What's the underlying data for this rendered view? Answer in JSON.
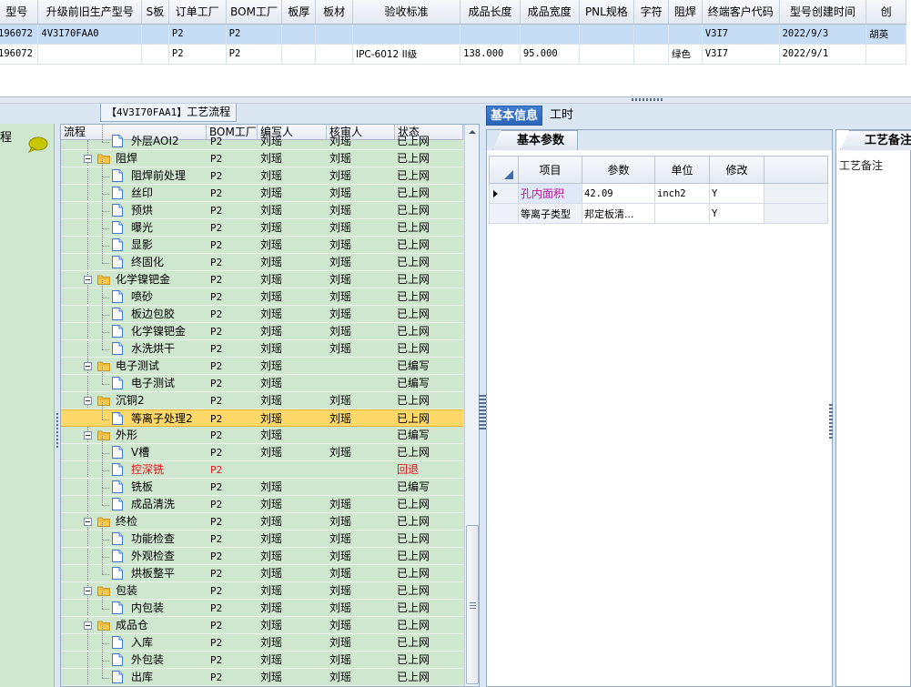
{
  "top_grid": {
    "columns": [
      "型号",
      "升级前旧生产型号",
      "S板",
      "订单工厂",
      "BOM工厂",
      "板厚",
      "板材",
      "验收标准",
      "成品长度",
      "成品宽度",
      "PNL规格",
      "字符",
      "阻焊",
      "终端客户代码",
      "型号创建时间",
      "创"
    ],
    "rows": [
      [
        "196072",
        "4V3I70FAA0",
        "",
        "P2",
        "P2",
        "",
        "",
        "",
        "",
        "",
        "",
        "",
        "",
        "V3I7",
        "2022/9/3",
        "胡英"
      ],
      [
        "196072",
        "",
        "",
        "P2",
        "P2",
        "",
        "",
        "IPC-6012 II级",
        "138.000",
        "95.000",
        "",
        "",
        "绿色",
        "V3I7",
        "2022/9/1",
        ""
      ]
    ]
  },
  "left_strip": {
    "label": "程",
    "icon": "speech-bubble-icon"
  },
  "tree_panel": {
    "title_code": "【4V3I70FAA1】",
    "title_text": "工艺流程",
    "columns": [
      "流程",
      "BOM工厂",
      "编写人",
      "核审人",
      "状态"
    ],
    "rows": [
      {
        "name": "外层AOI2",
        "level": 1,
        "type": "doc",
        "bom": "P2",
        "author": "刘瑶",
        "reviewer": "刘瑶",
        "status": "已上网"
      },
      {
        "name": "阻焊",
        "level": 0,
        "type": "folder",
        "bom": "P2",
        "author": "刘瑶",
        "reviewer": "刘瑶",
        "status": "已上网"
      },
      {
        "name": "阻焊前处理",
        "level": 1,
        "type": "doc",
        "bom": "P2",
        "author": "刘瑶",
        "reviewer": "刘瑶",
        "status": "已上网"
      },
      {
        "name": "丝印",
        "level": 1,
        "type": "doc",
        "bom": "P2",
        "author": "刘瑶",
        "reviewer": "刘瑶",
        "status": "已上网"
      },
      {
        "name": "预烘",
        "level": 1,
        "type": "doc",
        "bom": "P2",
        "author": "刘瑶",
        "reviewer": "刘瑶",
        "status": "已上网"
      },
      {
        "name": "曝光",
        "level": 1,
        "type": "doc",
        "bom": "P2",
        "author": "刘瑶",
        "reviewer": "刘瑶",
        "status": "已上网"
      },
      {
        "name": "显影",
        "level": 1,
        "type": "doc",
        "bom": "P2",
        "author": "刘瑶",
        "reviewer": "刘瑶",
        "status": "已上网"
      },
      {
        "name": "终固化",
        "level": 1,
        "type": "doc",
        "bom": "P2",
        "author": "刘瑶",
        "reviewer": "刘瑶",
        "status": "已上网"
      },
      {
        "name": "化学镍钯金",
        "level": 0,
        "type": "folder",
        "bom": "P2",
        "author": "刘瑶",
        "reviewer": "刘瑶",
        "status": "已上网"
      },
      {
        "name": "喷砂",
        "level": 1,
        "type": "doc",
        "bom": "P2",
        "author": "刘瑶",
        "reviewer": "刘瑶",
        "status": "已上网"
      },
      {
        "name": "板边包胶",
        "level": 1,
        "type": "doc",
        "bom": "P2",
        "author": "刘瑶",
        "reviewer": "刘瑶",
        "status": "已上网"
      },
      {
        "name": "化学镍钯金",
        "level": 1,
        "type": "doc",
        "bom": "P2",
        "author": "刘瑶",
        "reviewer": "刘瑶",
        "status": "已上网"
      },
      {
        "name": "水洗烘干",
        "level": 1,
        "type": "doc",
        "bom": "P2",
        "author": "刘瑶",
        "reviewer": "刘瑶",
        "status": "已上网"
      },
      {
        "name": "电子测试",
        "level": 0,
        "type": "folder",
        "bom": "P2",
        "author": "刘瑶",
        "reviewer": "",
        "status": "已编写"
      },
      {
        "name": "电子测试",
        "level": 1,
        "type": "doc",
        "bom": "P2",
        "author": "刘瑶",
        "reviewer": "",
        "status": "已编写"
      },
      {
        "name": "沉铜2",
        "level": 0,
        "type": "folder",
        "bom": "P2",
        "author": "刘瑶",
        "reviewer": "刘瑶",
        "status": "已上网"
      },
      {
        "name": "等离子处理2",
        "level": 1,
        "type": "doc",
        "bom": "P2",
        "author": "刘瑶",
        "reviewer": "刘瑶",
        "status": "已上网",
        "selected": true
      },
      {
        "name": "外形",
        "level": 0,
        "type": "folder",
        "bom": "P2",
        "author": "刘瑶",
        "reviewer": "",
        "status": "已编写"
      },
      {
        "name": "V槽",
        "level": 1,
        "type": "doc",
        "bom": "P2",
        "author": "刘瑶",
        "reviewer": "刘瑶",
        "status": "已上网"
      },
      {
        "name": "控深铣",
        "level": 1,
        "type": "doc",
        "bom": "P2",
        "author": "",
        "reviewer": "",
        "status": "回退",
        "red": true
      },
      {
        "name": "铣板",
        "level": 1,
        "type": "doc",
        "bom": "P2",
        "author": "刘瑶",
        "reviewer": "",
        "status": "已编写"
      },
      {
        "name": "成品清洗",
        "level": 1,
        "type": "doc",
        "bom": "P2",
        "author": "刘瑶",
        "reviewer": "刘瑶",
        "status": "已上网"
      },
      {
        "name": "终检",
        "level": 0,
        "type": "folder",
        "bom": "P2",
        "author": "刘瑶",
        "reviewer": "刘瑶",
        "status": "已上网"
      },
      {
        "name": "功能检查",
        "level": 1,
        "type": "doc",
        "bom": "P2",
        "author": "刘瑶",
        "reviewer": "刘瑶",
        "status": "已上网"
      },
      {
        "name": "外观检查",
        "level": 1,
        "type": "doc",
        "bom": "P2",
        "author": "刘瑶",
        "reviewer": "刘瑶",
        "status": "已上网"
      },
      {
        "name": "烘板整平",
        "level": 1,
        "type": "doc",
        "bom": "P2",
        "author": "刘瑶",
        "reviewer": "刘瑶",
        "status": "已上网"
      },
      {
        "name": "包装",
        "level": 0,
        "type": "folder",
        "bom": "P2",
        "author": "刘瑶",
        "reviewer": "刘瑶",
        "status": "已上网"
      },
      {
        "name": "内包装",
        "level": 1,
        "type": "doc",
        "bom": "P2",
        "author": "刘瑶",
        "reviewer": "刘瑶",
        "status": "已上网"
      },
      {
        "name": "成品仓",
        "level": 0,
        "type": "folder",
        "bom": "P2",
        "author": "刘瑶",
        "reviewer": "刘瑶",
        "status": "已上网"
      },
      {
        "name": "入库",
        "level": 1,
        "type": "doc",
        "bom": "P2",
        "author": "刘瑶",
        "reviewer": "刘瑶",
        "status": "已上网"
      },
      {
        "name": "外包装",
        "level": 1,
        "type": "doc",
        "bom": "P2",
        "author": "刘瑶",
        "reviewer": "刘瑶",
        "status": "已上网"
      },
      {
        "name": "出库",
        "level": 1,
        "type": "doc",
        "bom": "P2",
        "author": "刘瑶",
        "reviewer": "刘瑶",
        "status": "已上网"
      }
    ]
  },
  "right_panel": {
    "tabs": [
      {
        "label": "基本信息",
        "active": true
      },
      {
        "label": "工时",
        "active": false
      }
    ],
    "params_tab": "基本参数",
    "remark_tab": "工艺备注",
    "remark_label": "工艺备注",
    "param_columns": [
      "项目",
      "参数",
      "单位",
      "修改"
    ],
    "param_rows": [
      {
        "item": "孔内面积",
        "value": "42.09",
        "unit": "inch2",
        "modify": "Y",
        "current": true
      },
      {
        "item": "等离子类型",
        "value": "邦定板清...",
        "unit": "",
        "modify": "Y",
        "current": false
      }
    ]
  },
  "colors": {
    "tree_bg": "#cfe6cf",
    "selection": "#ffd86a",
    "tab_active": "#2f6cc4",
    "error_red": "#e4141b",
    "highlight_magenta": "#c0139c"
  }
}
